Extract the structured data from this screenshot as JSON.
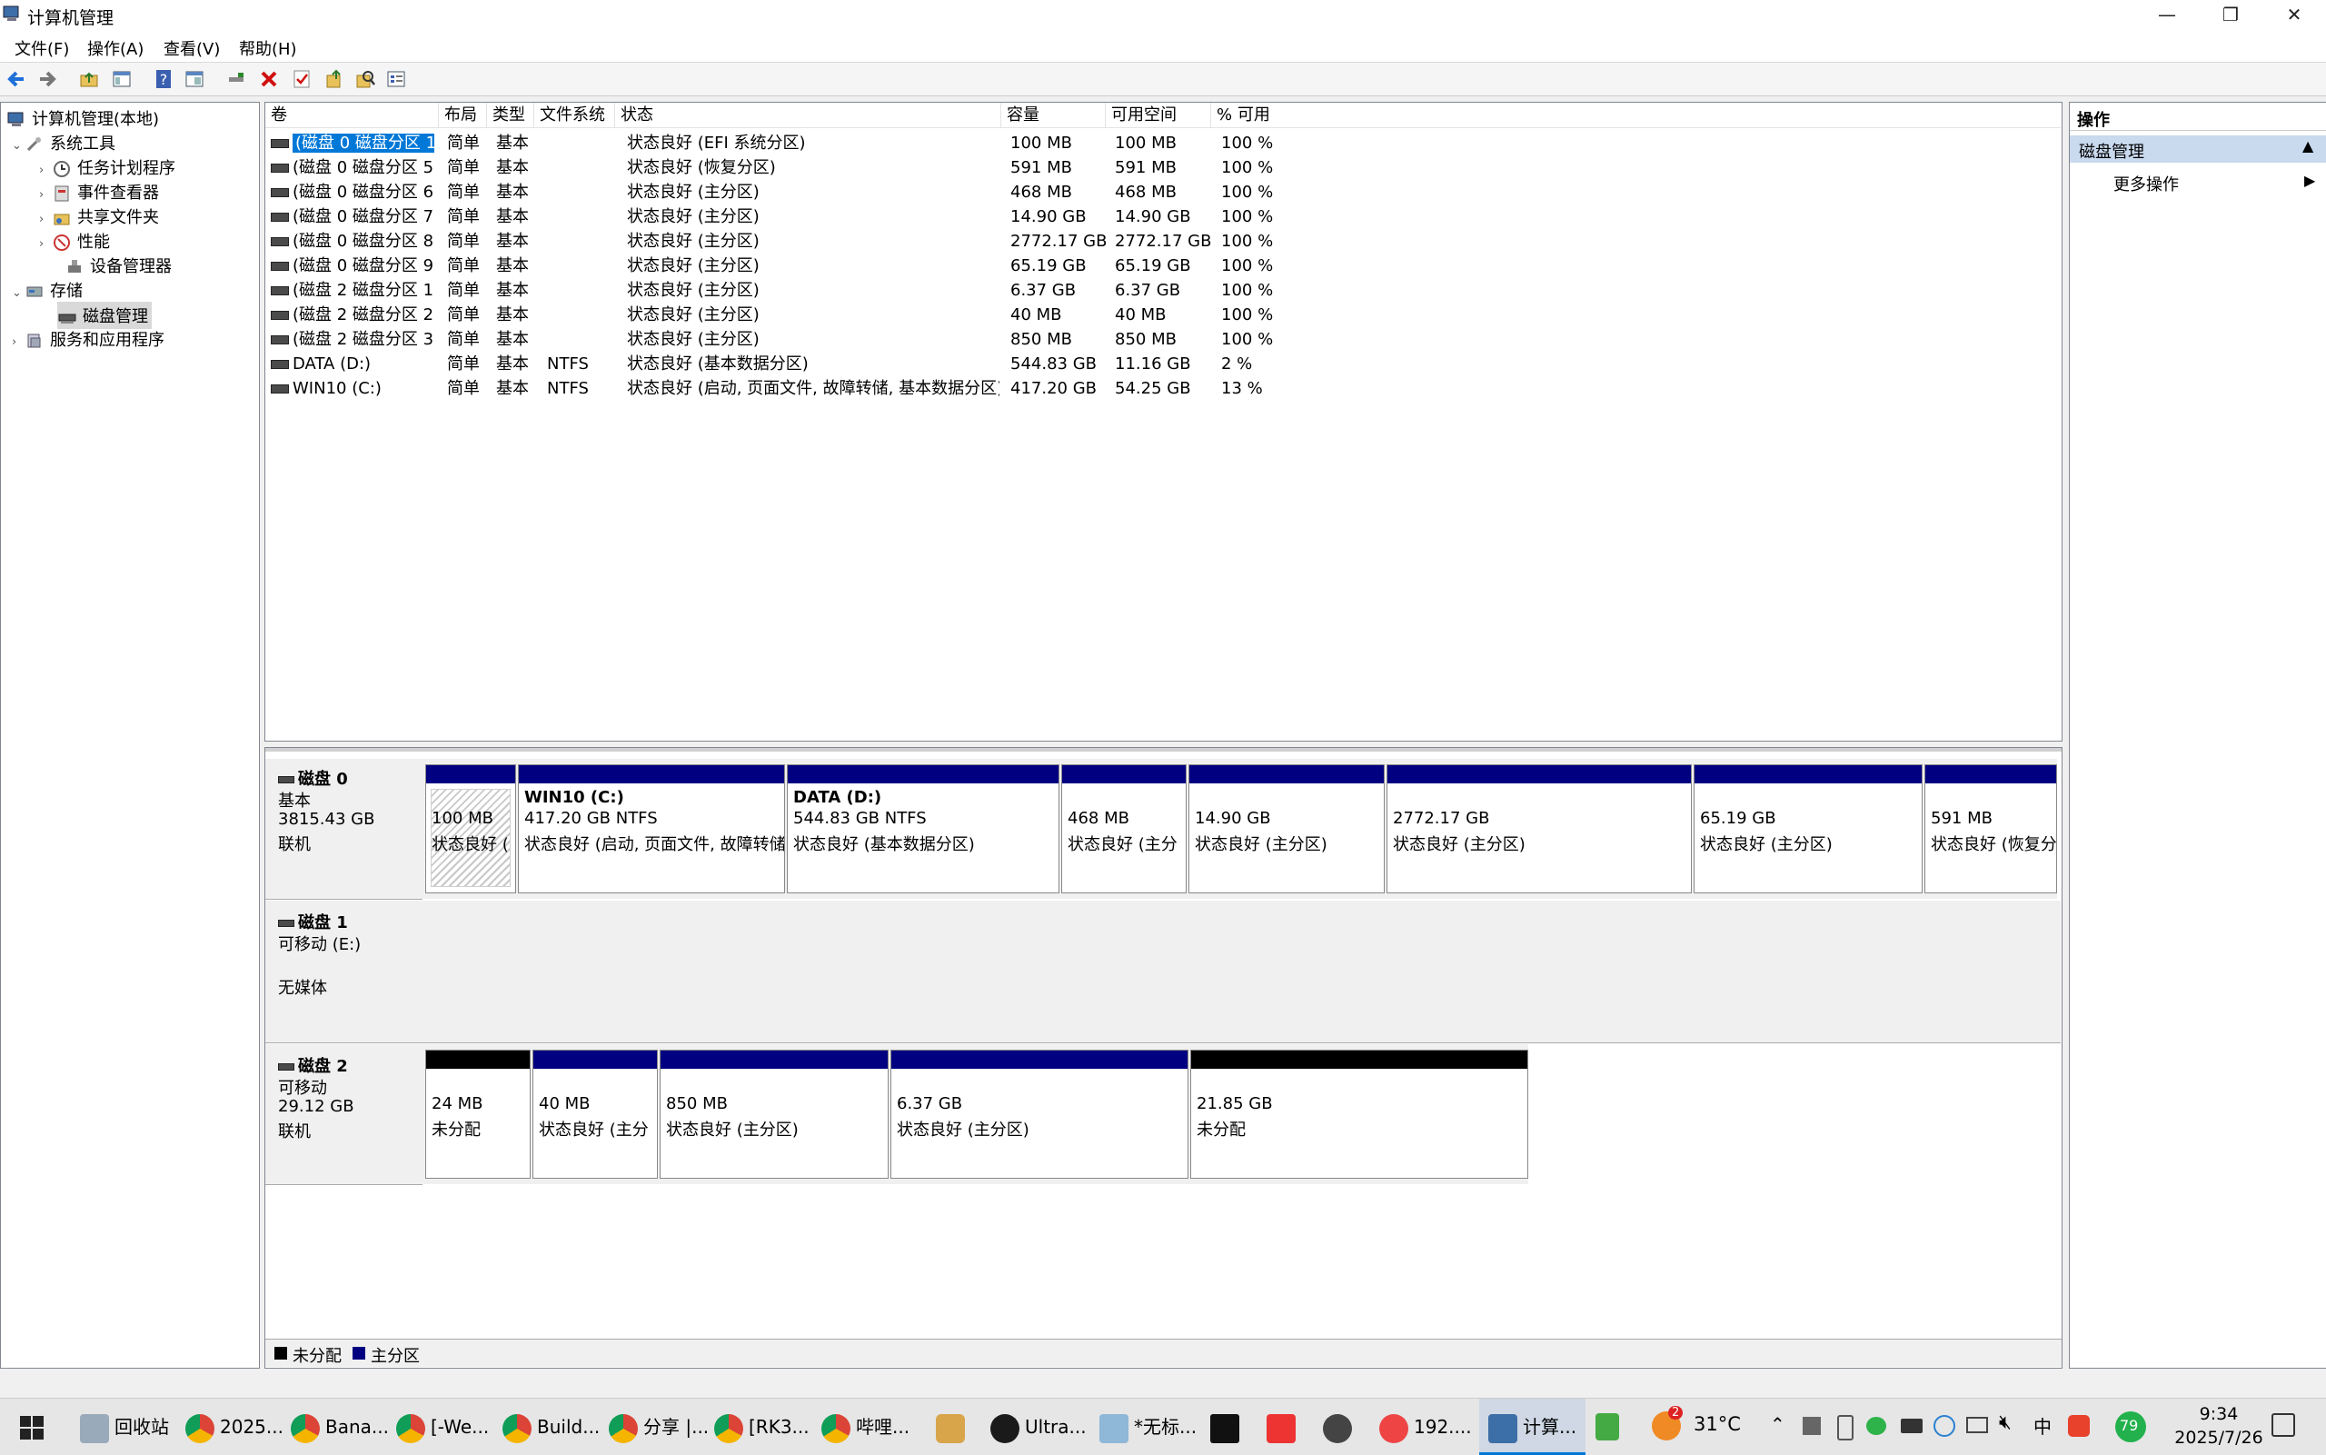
{
  "window": {
    "title": "计算机管理",
    "controls": {
      "minimize": "—",
      "restore": "❐",
      "close": "✕"
    }
  },
  "menu": [
    "文件(F)",
    "操作(A)",
    "查看(V)",
    "帮助(H)"
  ],
  "toolbar_icons": [
    "back-icon",
    "forward-icon",
    "up-folder-icon",
    "show-tree-icon",
    "help-icon",
    "console-icon",
    "connect-icon",
    "delete-icon",
    "check-icon",
    "export-icon",
    "search-icon",
    "properties-icon"
  ],
  "tree": {
    "root": "计算机管理(本地)",
    "system_tools": "系统工具",
    "task_scheduler": "任务计划程序",
    "event_viewer": "事件查看器",
    "shared_folders": "共享文件夹",
    "performance": "性能",
    "device_manager": "设备管理器",
    "storage": "存储",
    "disk_management": "磁盘管理",
    "services": "服务和应用程序"
  },
  "list": {
    "columns": [
      "卷",
      "布局",
      "类型",
      "文件系统",
      "状态",
      "容量",
      "可用空间",
      "% 可用"
    ],
    "rows": [
      {
        "vol": "(磁盘 0 磁盘分区 1)",
        "layout": "简单",
        "type": "基本",
        "fs": "",
        "status": "状态良好 (EFI 系统分区)",
        "cap": "100 MB",
        "free": "100 MB",
        "pct": "100 %"
      },
      {
        "vol": "(磁盘 0 磁盘分区 5)",
        "layout": "简单",
        "type": "基本",
        "fs": "",
        "status": "状态良好 (恢复分区)",
        "cap": "591 MB",
        "free": "591 MB",
        "pct": "100 %"
      },
      {
        "vol": "(磁盘 0 磁盘分区 6)",
        "layout": "简单",
        "type": "基本",
        "fs": "",
        "status": "状态良好 (主分区)",
        "cap": "468 MB",
        "free": "468 MB",
        "pct": "100 %"
      },
      {
        "vol": "(磁盘 0 磁盘分区 7)",
        "layout": "简单",
        "type": "基本",
        "fs": "",
        "status": "状态良好 (主分区)",
        "cap": "14.90 GB",
        "free": "14.90 GB",
        "pct": "100 %"
      },
      {
        "vol": "(磁盘 0 磁盘分区 8)",
        "layout": "简单",
        "type": "基本",
        "fs": "",
        "status": "状态良好 (主分区)",
        "cap": "2772.17 GB",
        "free": "2772.17 GB",
        "pct": "100 %"
      },
      {
        "vol": "(磁盘 0 磁盘分区 9)",
        "layout": "简单",
        "type": "基本",
        "fs": "",
        "status": "状态良好 (主分区)",
        "cap": "65.19 GB",
        "free": "65.19 GB",
        "pct": "100 %"
      },
      {
        "vol": "(磁盘 2 磁盘分区 1)",
        "layout": "简单",
        "type": "基本",
        "fs": "",
        "status": "状态良好 (主分区)",
        "cap": "6.37 GB",
        "free": "6.37 GB",
        "pct": "100 %"
      },
      {
        "vol": "(磁盘 2 磁盘分区 2)",
        "layout": "简单",
        "type": "基本",
        "fs": "",
        "status": "状态良好 (主分区)",
        "cap": "40 MB",
        "free": "40 MB",
        "pct": "100 %"
      },
      {
        "vol": "(磁盘 2 磁盘分区 3)",
        "layout": "简单",
        "type": "基本",
        "fs": "",
        "status": "状态良好 (主分区)",
        "cap": "850 MB",
        "free": "850 MB",
        "pct": "100 %"
      },
      {
        "vol": "DATA (D:)",
        "layout": "简单",
        "type": "基本",
        "fs": "NTFS",
        "status": "状态良好 (基本数据分区)",
        "cap": "544.83 GB",
        "free": "11.16 GB",
        "pct": "2 %"
      },
      {
        "vol": "WIN10 (C:)",
        "layout": "简单",
        "type": "基本",
        "fs": "NTFS",
        "status": "状态良好 (启动, 页面文件, 故障转储, 基本数据分区)",
        "cap": "417.20 GB",
        "free": "54.25 GB",
        "pct": "13 %"
      }
    ]
  },
  "disks": {
    "disk0": {
      "name": "磁盘 0",
      "type": "基本",
      "size": "3815.43 GB",
      "state": "联机",
      "parts": [
        {
          "l1": "",
          "l2": "100 MB",
          "l3": "状态良好 ("
        },
        {
          "l1": "WIN10  (C:)",
          "l2": "417.20 GB NTFS",
          "l3": "状态良好 (启动, 页面文件, 故障转储"
        },
        {
          "l1": "DATA  (D:)",
          "l2": "544.83 GB NTFS",
          "l3": "状态良好 (基本数据分区)"
        },
        {
          "l1": "",
          "l2": "468 MB",
          "l3": "状态良好 (主分"
        },
        {
          "l1": "",
          "l2": "14.90 GB",
          "l3": "状态良好 (主分区)"
        },
        {
          "l1": "",
          "l2": "2772.17 GB",
          "l3": "状态良好 (主分区)"
        },
        {
          "l1": "",
          "l2": "65.19 GB",
          "l3": "状态良好 (主分区)"
        },
        {
          "l1": "",
          "l2": "591 MB",
          "l3": "状态良好 (恢复分"
        }
      ]
    },
    "disk1": {
      "name": "磁盘 1",
      "type": "可移动 (E:)",
      "media": "无媒体"
    },
    "disk2": {
      "name": "磁盘 2",
      "type": "可移动",
      "size": "29.12 GB",
      "state": "联机",
      "parts": [
        {
          "l2": "24 MB",
          "l3": "未分配"
        },
        {
          "l2": "40 MB",
          "l3": "状态良好 (主分"
        },
        {
          "l2": "850 MB",
          "l3": "状态良好 (主分区)"
        },
        {
          "l2": "6.37 GB",
          "l3": "状态良好 (主分区)"
        },
        {
          "l2": "21.85 GB",
          "l3": "未分配"
        }
      ]
    }
  },
  "legend": {
    "unallocated": "未分配",
    "primary": "主分区"
  },
  "actions": {
    "header": "操作",
    "section": "磁盘管理",
    "more": "更多操作"
  },
  "taskbar": {
    "items": [
      "回收站",
      "2025...",
      "Bana...",
      "[-We...",
      "Build...",
      "分享 |...",
      "[RK3...",
      "哔哩...",
      "Ultra...",
      "*无标...",
      "192....",
      "计算..."
    ],
    "weather_badge": "2",
    "temperature": "31°C",
    "battery_badge": "79",
    "time": "9:34",
    "date": "2025/7/26"
  },
  "colors": {
    "primary": "#000080",
    "unallocated": "#000000",
    "selection": "#0078d7"
  }
}
